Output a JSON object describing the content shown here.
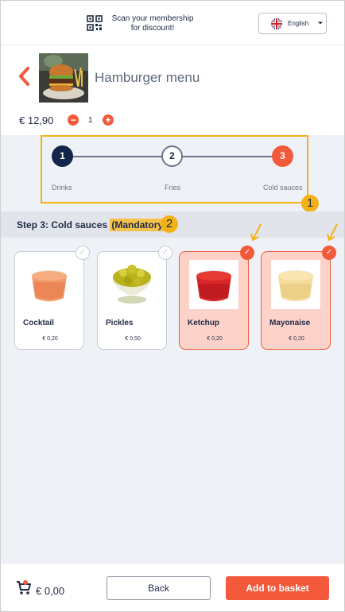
{
  "header": {
    "scan_text_line1": "Scan your membership",
    "scan_text_line2": "for discount!",
    "language": "English",
    "icons": [
      "qr-code-icon",
      "uk-flag-icon",
      "chevron-down-icon"
    ]
  },
  "product": {
    "title": "Hamburger menu",
    "price": "€ 12,90",
    "quantity": "1",
    "minus": "−",
    "plus": "+"
  },
  "stepper": {
    "steps": [
      {
        "number": "1",
        "label": "Drinks",
        "state": "completed"
      },
      {
        "number": "2",
        "label": "Fries",
        "state": "pending"
      },
      {
        "number": "3",
        "label": "Cold sauces",
        "state": "active"
      }
    ],
    "annotation": "1"
  },
  "step_header": {
    "title": "Step 3: Cold sauces",
    "mandatory": "(Mandatory)",
    "annotation": "2"
  },
  "items": [
    {
      "name": "Cocktail",
      "price": "€ 0,20",
      "selected": false,
      "check": "✓"
    },
    {
      "name": "Pickles",
      "price": "€ 0,50",
      "selected": false,
      "check": "✓"
    },
    {
      "name": "Ketchup",
      "price": "€ 0,20",
      "selected": true,
      "check": "✓"
    },
    {
      "name": "Mayonaise",
      "price": "€ 0,20",
      "selected": true,
      "check": "✓"
    }
  ],
  "footer": {
    "total": "€ 0,00",
    "back_label": "Back",
    "add_label": "Add to basket"
  },
  "colors": {
    "accent": "#f25a3b",
    "navy": "#13254a",
    "highlight": "#f4b21a",
    "selected_bg": "#fcd2c9"
  }
}
